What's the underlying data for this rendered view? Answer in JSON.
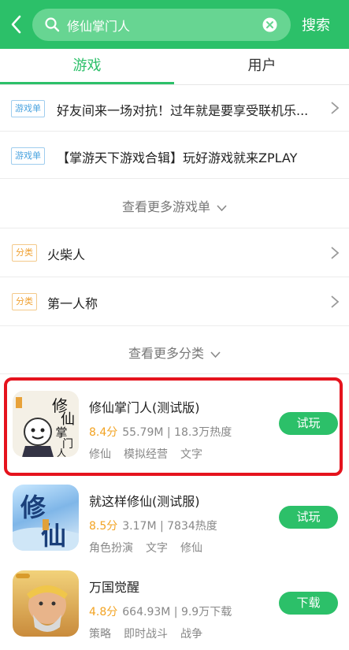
{
  "header": {
    "search_value": "修仙掌门人",
    "search_button": "搜索"
  },
  "tabs": [
    {
      "label": "游戏",
      "active": true
    },
    {
      "label": "用户",
      "active": false
    }
  ],
  "game_lists": [
    {
      "badge": "游戏单",
      "text": "好友间来一场对抗！过年就是要享受联机乐..."
    },
    {
      "badge": "游戏单",
      "text": "【掌游天下游戏合辑】玩好游戏就来ZPLAY"
    }
  ],
  "more_lists": "查看更多游戏单",
  "categories": [
    {
      "badge": "分类",
      "text": "火柴人"
    },
    {
      "badge": "分类",
      "text": "第一人称"
    }
  ],
  "more_categories": "查看更多分类",
  "games": [
    {
      "title": "修仙掌门人(测试版)",
      "score": "8.4分",
      "meta": "55.79M | 18.3万热度",
      "tags": [
        "修仙",
        "模拟经营",
        "文字"
      ],
      "button": "试玩",
      "icon": "xiuxian-zhangmenren-icon"
    },
    {
      "title": "就这样修仙(测试服)",
      "score": "8.5分",
      "meta": "3.17M | 7834热度",
      "tags": [
        "角色扮演",
        "文字",
        "修仙"
      ],
      "button": "试玩",
      "icon": "jiuzheyang-xiuxian-icon"
    },
    {
      "title": "万国觉醒",
      "score": "4.8分",
      "meta": "664.93M | 9.9万下载",
      "tags": [
        "策略",
        "即时战斗",
        "战争"
      ],
      "button": "下载",
      "icon": "wanguo-juexing-icon"
    }
  ],
  "icon_art": {
    "g1": [
      "修",
      "仙",
      "掌",
      "门",
      "人"
    ],
    "g2": [
      "修",
      "仙"
    ]
  },
  "colors": {
    "brand": "#2cc069",
    "highlight": "#e5131d",
    "score": "#f2a322"
  }
}
